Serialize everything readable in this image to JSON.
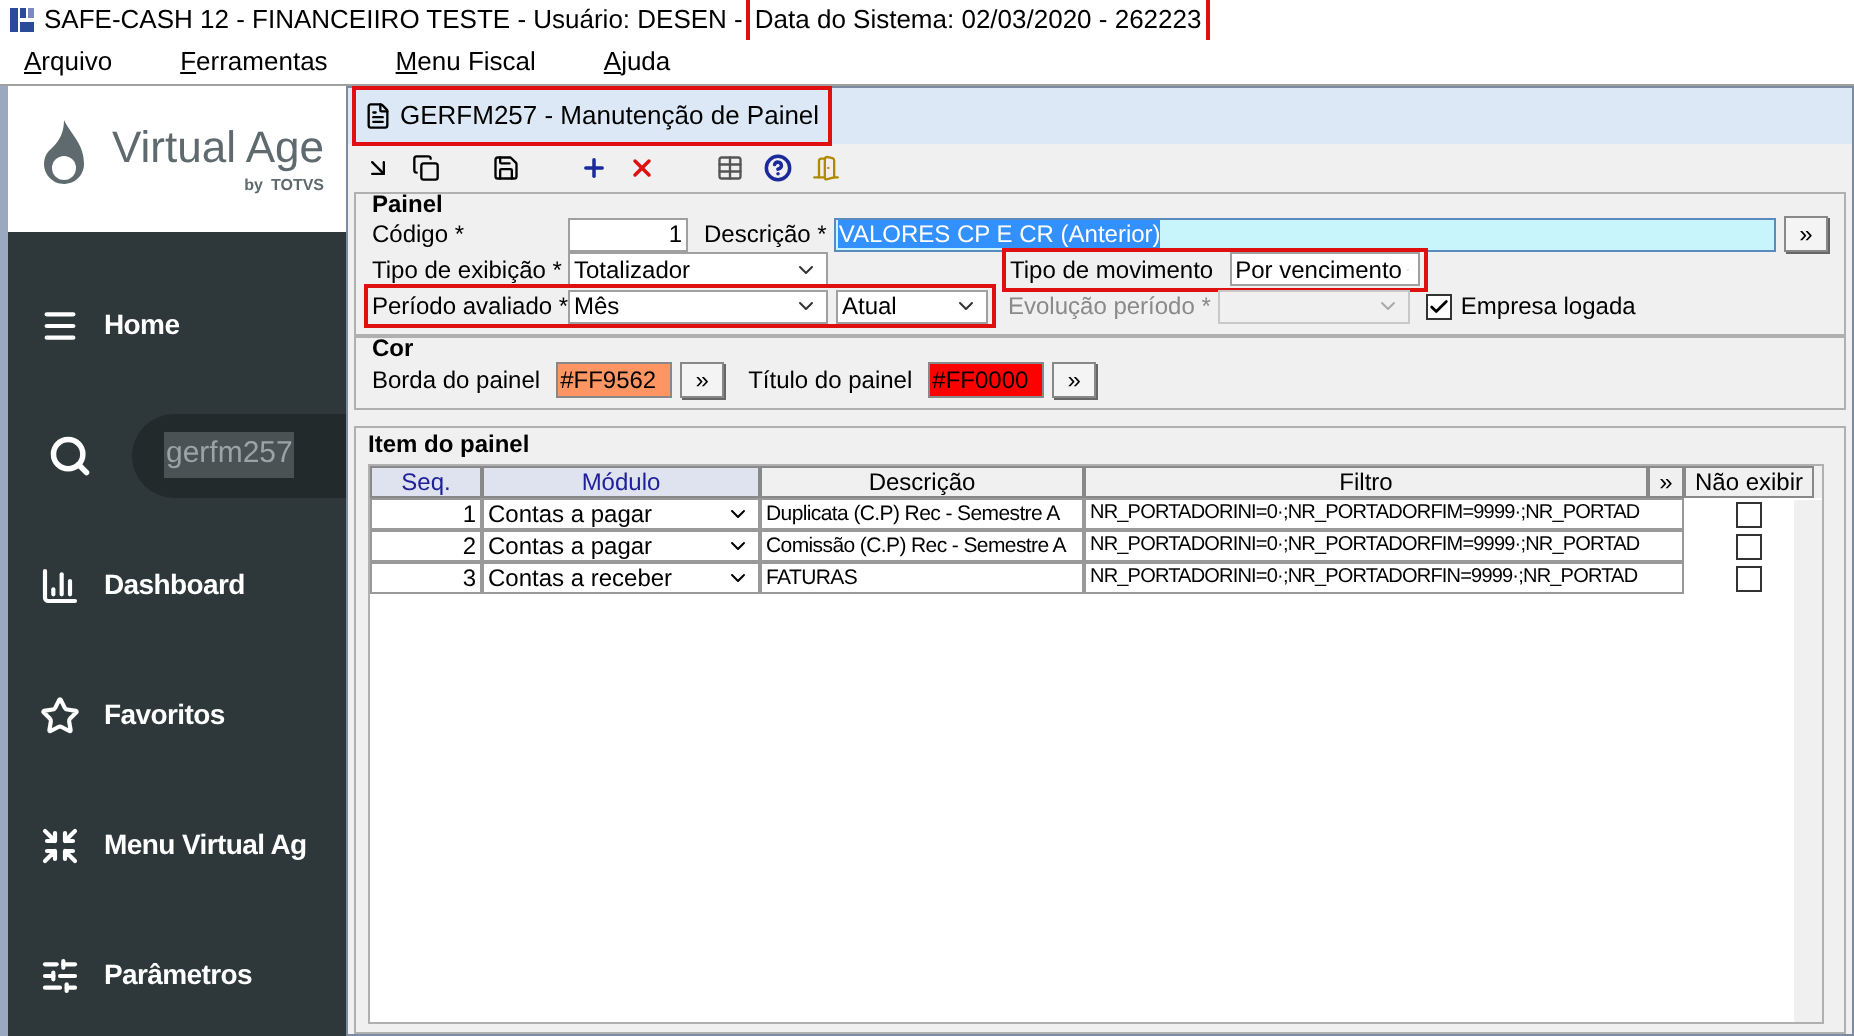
{
  "app_title": {
    "text": "SAFE-CASH 12 - FINANCEIIRO TESTE - Usuário: DESEN -",
    "system_date": "Data do Sistema: 02/03/2020 - 262223",
    "highlighted": true
  },
  "menu": [
    {
      "label": "Arquivo"
    },
    {
      "label": "Ferramentas"
    },
    {
      "label": "Menu Fiscal"
    },
    {
      "label": "Ajuda"
    }
  ],
  "sidebar": {
    "logo": {
      "name": "Virtual Age",
      "tagline": "by",
      "brand": "TOTVS"
    },
    "items": [
      {
        "kind": "nav",
        "label": "Home"
      },
      {
        "kind": "search",
        "value": "gerfm257"
      },
      {
        "kind": "nav",
        "label": "Dashboard"
      },
      {
        "kind": "nav",
        "label": "Favoritos"
      },
      {
        "kind": "nav",
        "label": "Menu Virtual Ag"
      },
      {
        "kind": "nav",
        "label": "Parâmetros"
      }
    ]
  },
  "window": {
    "title": "GERFM257 - Manutenção de Painel",
    "highlighted": true
  },
  "painel": {
    "legend": "Painel",
    "codigo": {
      "label": "Código *",
      "value": "1"
    },
    "descricao": {
      "label": "Descrição *",
      "value": "VALORES CP E CR (Anterior)",
      "button": "»"
    },
    "tipo_exibicao": {
      "label": "Tipo de exibição *",
      "value": "Totalizador"
    },
    "tipo_movimento": {
      "label": "Tipo de movimento",
      "value": "Por vencimento",
      "highlighted": true
    },
    "periodo": {
      "label": "Período avaliado *",
      "value": "Mês",
      "value_2": "Atual",
      "highlighted": true
    },
    "evolucao": {
      "label": "Evolução período *",
      "disabled": true
    },
    "empresa_logada": {
      "label": "Empresa logada",
      "checked": true
    }
  },
  "cor": {
    "legend": "Cor",
    "fields": [
      {
        "label": "Borda do painel",
        "value": "#FF9562",
        "color": "#ff9562",
        "button": "»"
      },
      {
        "label": "Título do painel",
        "value": "#FF0000",
        "color": "#ff0000",
        "button": "»"
      }
    ]
  },
  "items": {
    "legend": "Item do painel",
    "columns": [
      "Seq.",
      "Módulo",
      "Descrição",
      "Filtro",
      "»",
      "Não exibir"
    ],
    "rows": [
      {
        "seq": "1",
        "modulo": "Contas a pagar",
        "descricao": "Duplicata (C.P) Rec - Semestre A",
        "filtro": "NR_PORTADORINI=0·;NR_PORTADORFIM=9999·;NR_PORTAD",
        "hidden": false
      },
      {
        "seq": "2",
        "modulo": "Contas a pagar",
        "descricao": "Comissão (C.P) Rec - Semestre A",
        "filtro": "NR_PORTADORINI=0·;NR_PORTADORFIM=9999·;NR_PORTAD",
        "hidden": false
      },
      {
        "seq": "3",
        "modulo": "Contas a receber",
        "descricao": "FATURAS",
        "filtro": "NR_PORTADORINI=0·;NR_PORTADORFIN=9999·;NR_PORTAD",
        "hidden": false
      }
    ]
  }
}
